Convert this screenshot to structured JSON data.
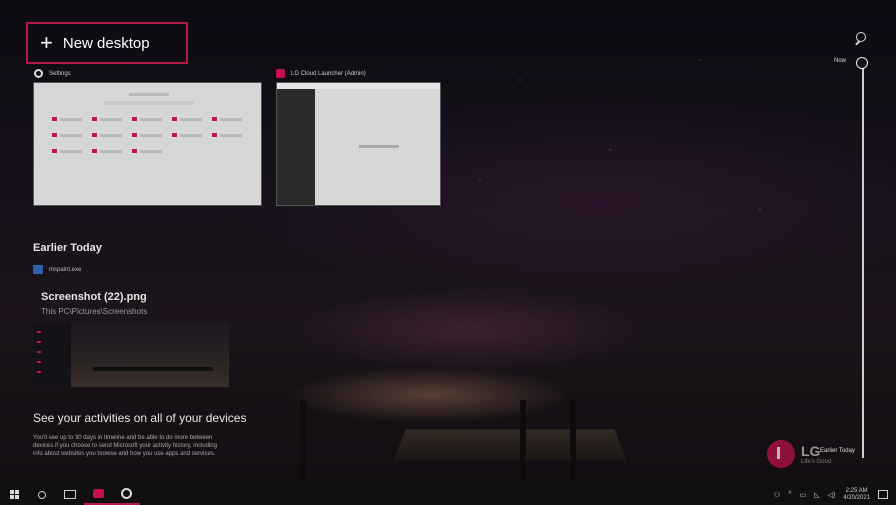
{
  "new_desktop": {
    "label": "New desktop"
  },
  "timeline": {
    "now_label": "Now",
    "earlier_label": "Earlier Today"
  },
  "windows": [
    {
      "title": "Settings",
      "icon": "gear-icon"
    },
    {
      "title": "LG Cloud Launcher (Admin)",
      "icon": "lg-icon"
    }
  ],
  "earlier": {
    "heading": "Earlier Today",
    "app_name": "mspaint.exe",
    "file_name": "Screenshot (22).png",
    "file_path": "This PC\\Pictures\\Screenshots"
  },
  "promo": {
    "heading": "See your activities on all of your devices",
    "body": "You'll see up to 30 days in timeline and be able to do more between devices if you choose to send Microsoft your activity history, including info about websites you browse and how you use apps and services."
  },
  "brand": {
    "word": "LG",
    "tagline": "Life's Good",
    "color": "#c3124a"
  },
  "taskbar": {
    "apps": [
      "windows-start-icon",
      "search-icon",
      "task-view-icon",
      "lg-cloud-icon",
      "settings-gear-icon"
    ],
    "time": "2:25 AM",
    "date": "4/20/2021"
  },
  "accent": "#b51a47"
}
